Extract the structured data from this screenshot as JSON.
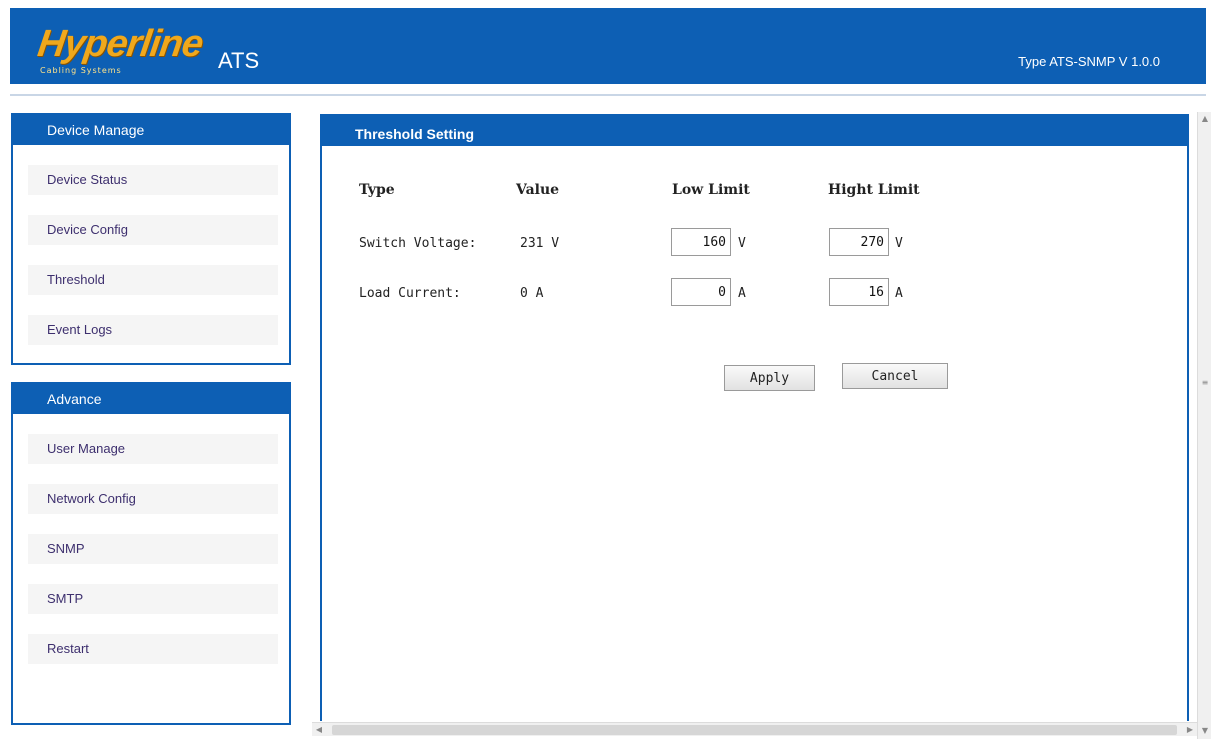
{
  "header": {
    "logo": "Hyperline",
    "logo_tagline": "Cabling Systems",
    "app_name": "ATS",
    "version": "Type ATS-SNMP V 1.0.0"
  },
  "sidebar": {
    "device_manage": {
      "title": "Device Manage",
      "items": [
        {
          "label": "Device Status"
        },
        {
          "label": "Device Config"
        },
        {
          "label": "Threshold"
        },
        {
          "label": "Event Logs"
        }
      ]
    },
    "advance": {
      "title": "Advance",
      "items": [
        {
          "label": "User Manage"
        },
        {
          "label": "Network Config"
        },
        {
          "label": "SNMP"
        },
        {
          "label": "SMTP"
        },
        {
          "label": "Restart"
        }
      ]
    }
  },
  "main": {
    "title": "Threshold Setting",
    "columns": {
      "type": "Type",
      "value": "Value",
      "low_limit": "Low Limit",
      "high_limit": "Hight Limit"
    },
    "rows": [
      {
        "type": "Switch Voltage:",
        "value": "231 V",
        "low": "160",
        "low_unit": "V",
        "high": "270",
        "high_unit": "V"
      },
      {
        "type": "Load Current:",
        "value": "0 A",
        "low": "0",
        "low_unit": "A",
        "high": "16",
        "high_unit": "A"
      }
    ],
    "buttons": {
      "apply": "Apply",
      "cancel": "Cancel"
    }
  },
  "icons": {
    "scroll_up": "arrow-up-icon",
    "scroll_down": "arrow-down-icon",
    "scroll_left": "arrow-left-icon",
    "scroll_right": "arrow-right-icon"
  },
  "colors": {
    "brand_blue": "#0d5fb4",
    "logo_orange": "#f0a81c"
  }
}
